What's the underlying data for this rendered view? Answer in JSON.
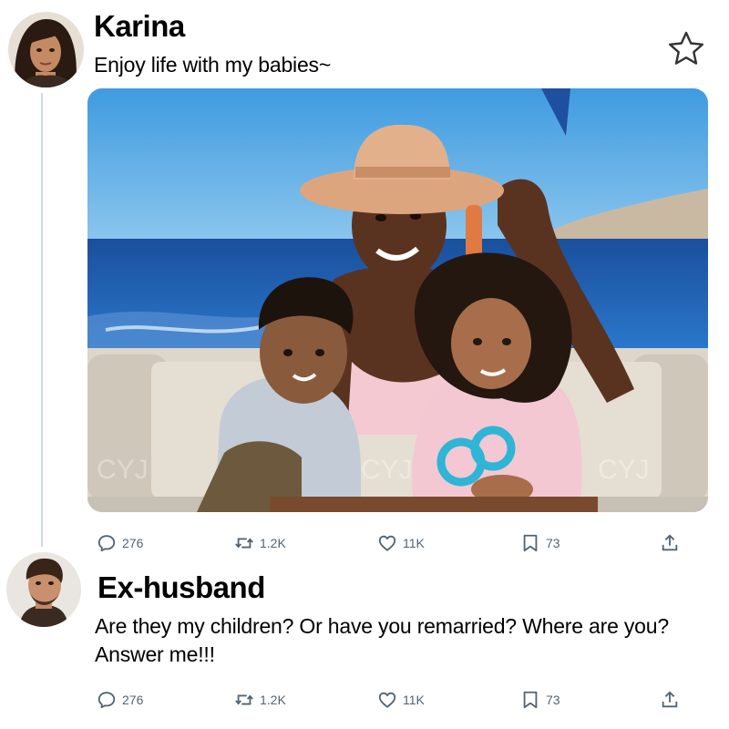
{
  "posts": [
    {
      "author": "Karina",
      "text": "Enjoy life with my babies~",
      "avatar_icon": "avatar-woman",
      "image": {
        "watermark": "CYJ",
        "alt": "mother-with-two-children-on-boat"
      },
      "stats": {
        "replies": "276",
        "reposts": "1.2K",
        "likes": "11K",
        "bookmarks": "73"
      }
    },
    {
      "author": "Ex-husband",
      "text": "Are they my children? Or have you remarried? Where are you? Answer me!!!",
      "avatar_icon": "avatar-man",
      "stats": {
        "replies": "276",
        "reposts": "1.2K",
        "likes": "11K",
        "bookmarks": "73"
      }
    }
  ],
  "icons": [
    "reply-icon",
    "repost-icon",
    "like-icon",
    "bookmark-icon",
    "share-icon",
    "star-icon"
  ],
  "colors": {
    "icon_gray": "#536471",
    "thread_line": "#cfd9de",
    "sea": "#1e63b4",
    "sky": "#5fb0e8"
  }
}
